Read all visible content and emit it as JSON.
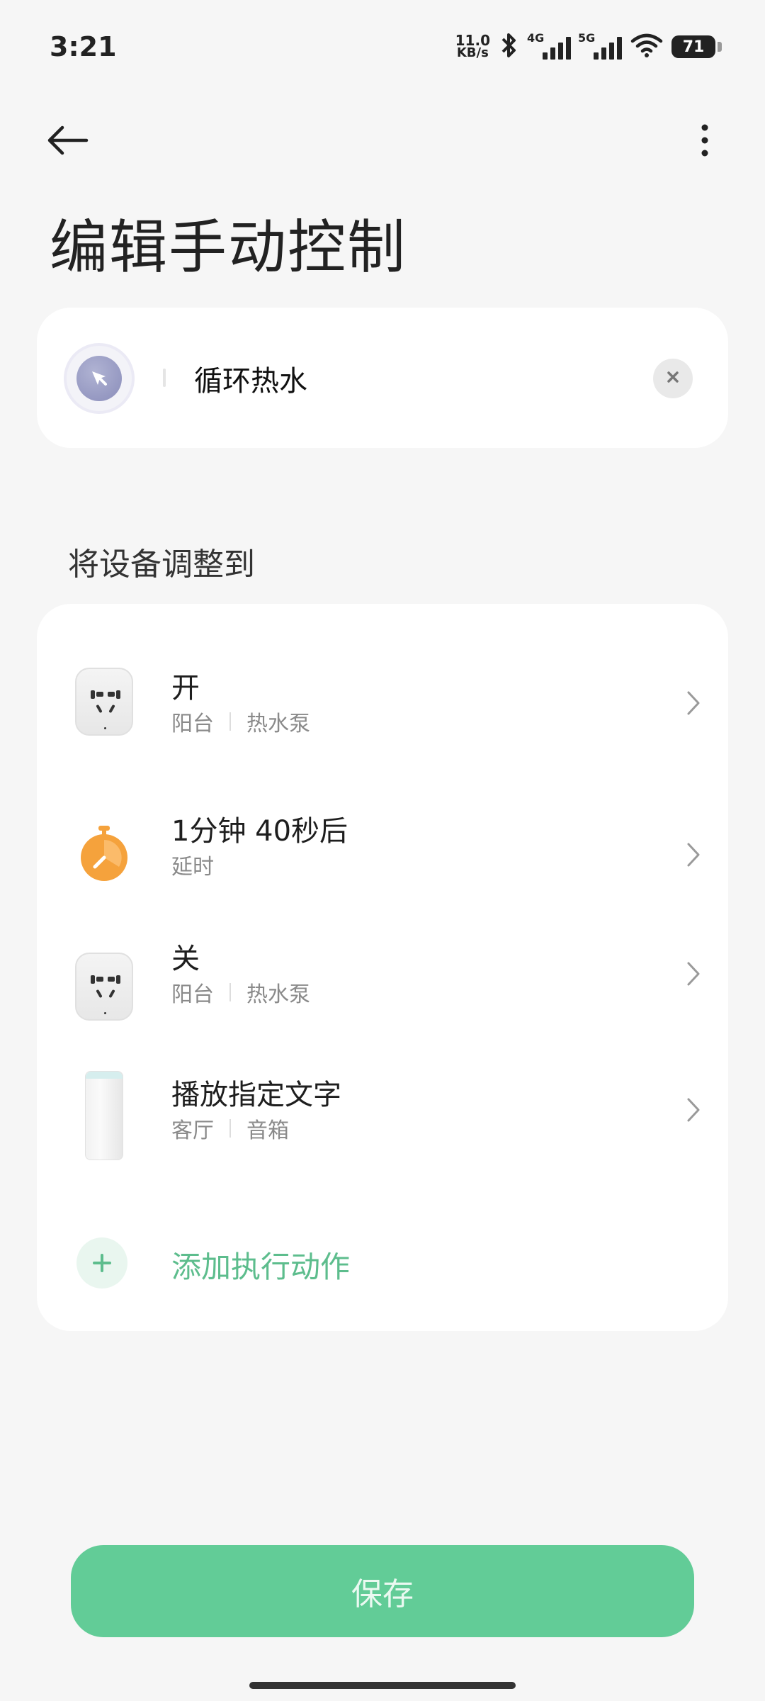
{
  "status_bar": {
    "time": "3:21",
    "net_speed_value": "11.0",
    "net_speed_unit": "KB/s",
    "net1_label": "4G",
    "net2_label": "5G",
    "battery": "71",
    "icons": [
      "bluetooth-icon",
      "signal-icon",
      "wifi-icon",
      "battery-icon"
    ]
  },
  "header": {
    "title": "编辑手动控制",
    "back_icon": "arrow-left-icon",
    "more_icon": "more-vertical-icon"
  },
  "scene": {
    "name": "循环热水",
    "icon": "pointer-click-icon",
    "clear_icon": "close-icon"
  },
  "section": {
    "label": "将设备调整到"
  },
  "actions": [
    {
      "title": "开",
      "room": "阳台",
      "device": "热水泵",
      "icon": "smart-plug-icon"
    },
    {
      "title": "1分钟 40秒后",
      "sub": "延时",
      "icon": "timer-icon"
    },
    {
      "title": "关",
      "room": "阳台",
      "device": "热水泵",
      "icon": "smart-plug-icon"
    },
    {
      "title": "播放指定文字",
      "room": "客厅",
      "device": "音箱",
      "icon": "speaker-icon"
    }
  ],
  "add_action": {
    "label": "添加执行动作",
    "icon": "plus-icon"
  },
  "save_button": {
    "label": "保存"
  },
  "colors": {
    "accent": "#62cc97",
    "accent_text": "#5dbd8d",
    "timer": "#f5a23c"
  }
}
